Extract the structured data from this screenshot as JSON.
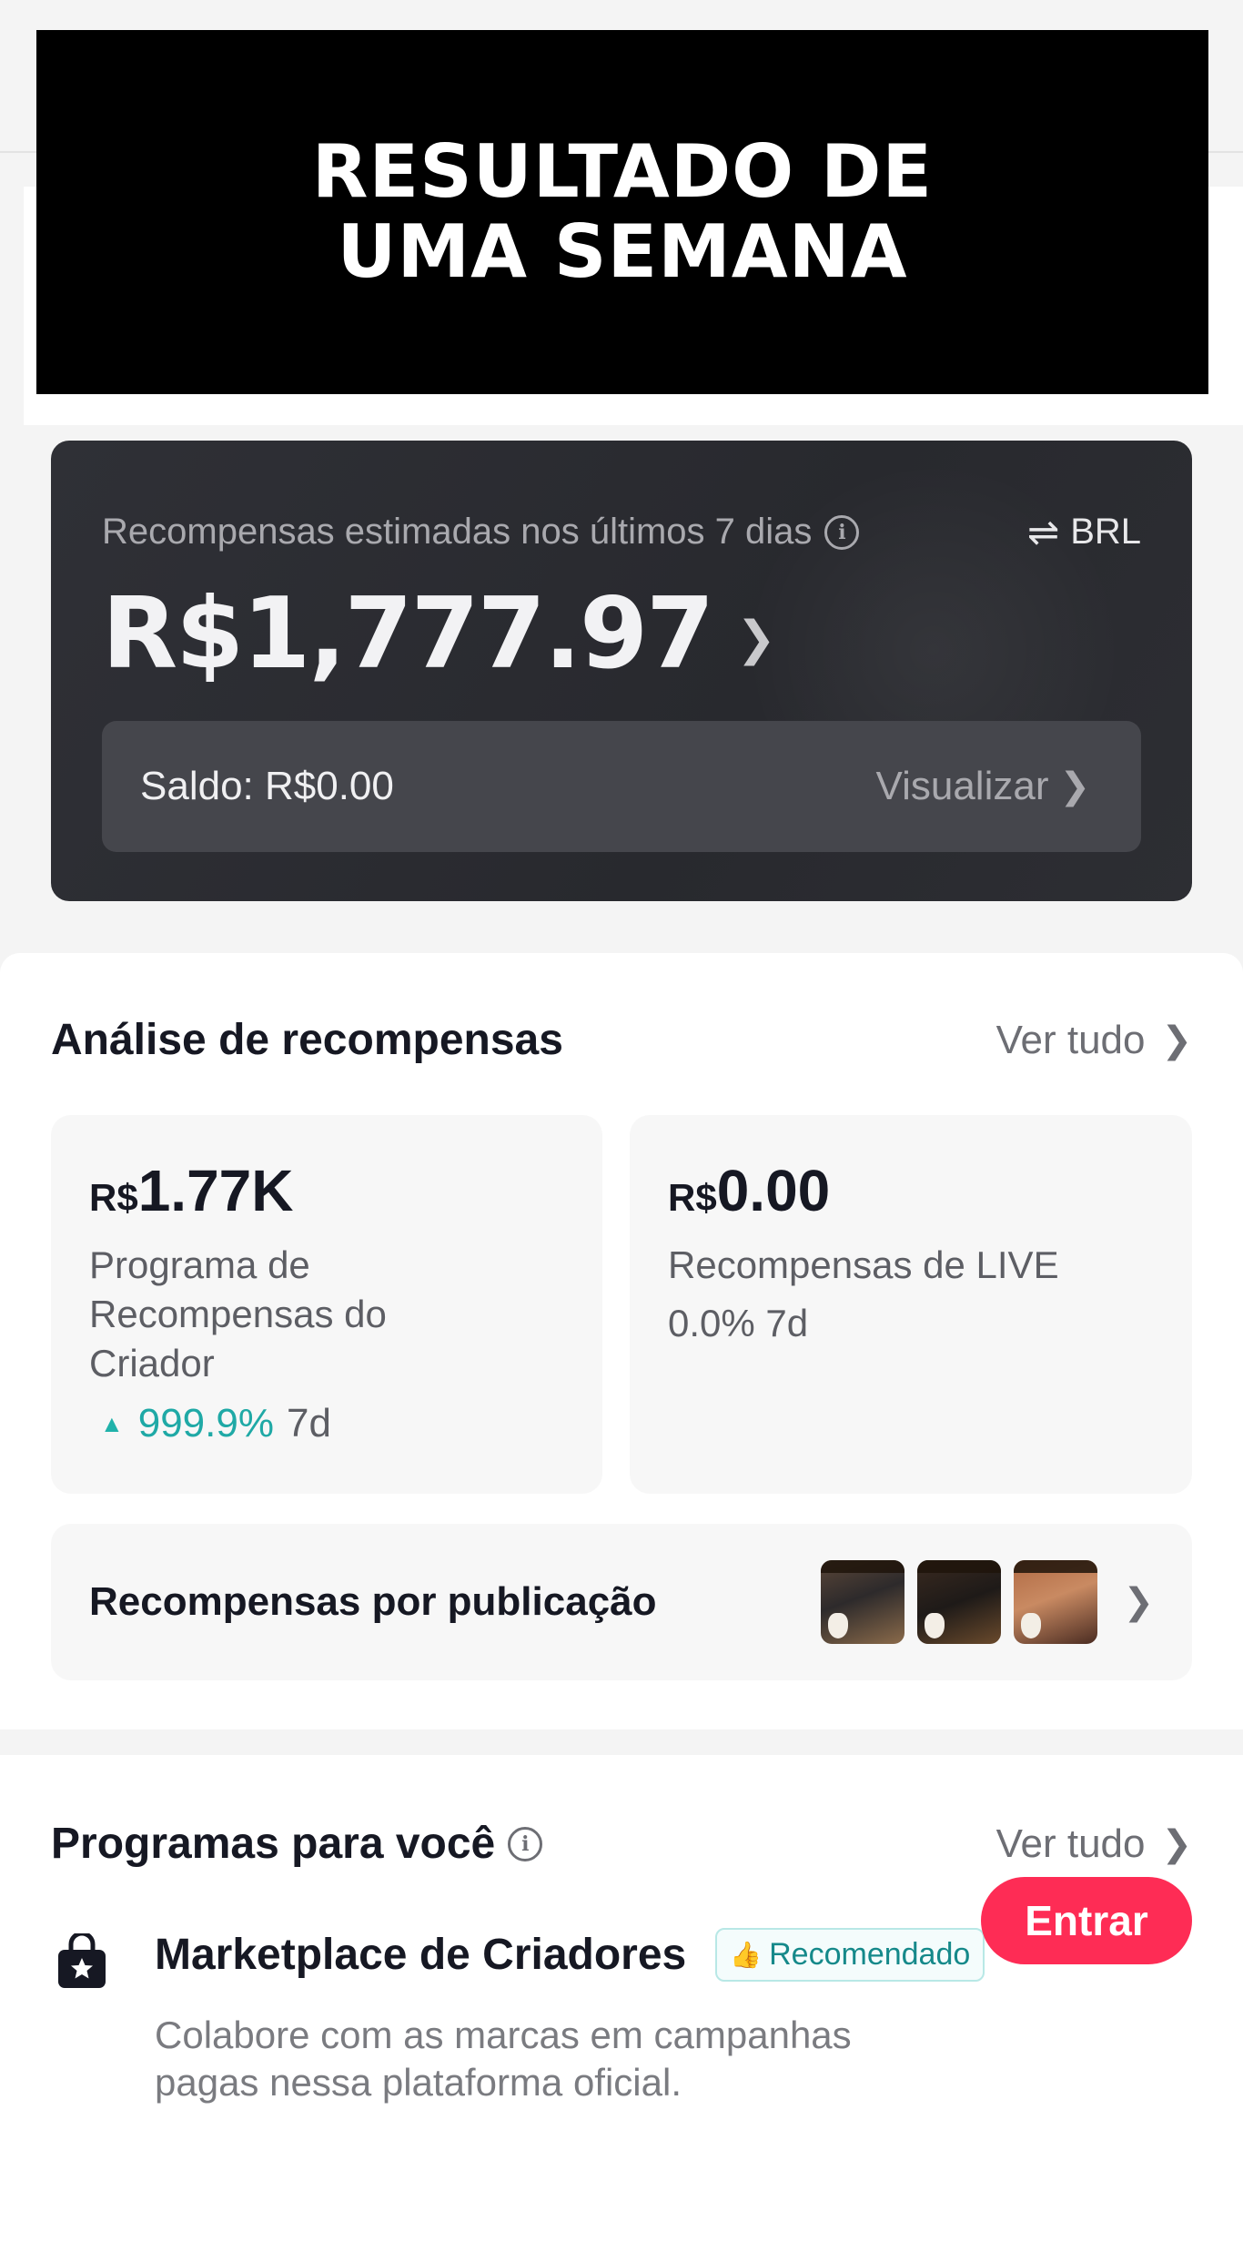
{
  "banner": {
    "text": "RESULTADO DE\nUMA SEMANA"
  },
  "rewards": {
    "label": "Recompensas estimadas nos últimos 7 dias",
    "info_icon": "info-icon",
    "currency": "BRL",
    "amount": "R$1,777.97",
    "balance": "Saldo: R$0.00",
    "view_label": "Visualizar"
  },
  "analise": {
    "title": "Análise de recompensas",
    "see_all": "Ver tudo",
    "cards": [
      {
        "currency": "R$",
        "value": "1.77K",
        "description": "Programa de Recompensas do Criador",
        "change_pct": "999.9%",
        "period": "7d",
        "trend": "up"
      },
      {
        "currency": "R$",
        "value": "0.00",
        "description": "Recompensas de LIVE",
        "change": "0.0% 7d"
      }
    ],
    "posts_label": "Recompensas por publicação"
  },
  "programas": {
    "title": "Programas para você",
    "see_all": "Ver tudo",
    "item": {
      "icon": "shopping-bag-star-icon",
      "title": "Marketplace de Criadores",
      "badge": "Recomendado",
      "description": "Colabore com as marcas em campanhas pagas nessa plataforma oficial.",
      "button": "Entrar"
    }
  },
  "colors": {
    "accent": "#fe2c55",
    "teal": "#1fa9a6",
    "dark_card": "#2c2d32"
  }
}
